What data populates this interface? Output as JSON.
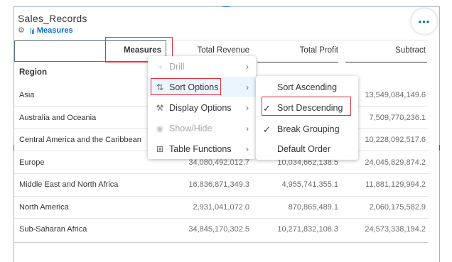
{
  "widget": {
    "title": "Sales_Records",
    "measure_link": "Measures",
    "more_label": "•••"
  },
  "table": {
    "header_dimension": "Measures",
    "columns": [
      "Total Revenue",
      "Total Profit",
      "Subtract"
    ],
    "row_header": "Region",
    "rows": [
      {
        "label": "Asia",
        "values": [
          "",
          "",
          "13,549,084,149.6"
        ]
      },
      {
        "label": "Australia and Oceania",
        "values": [
          "",
          "",
          "7,509,770,236.1"
        ]
      },
      {
        "label": "Central America and the Caribbean",
        "values": [
          "",
          "",
          "10,228,092,517.6"
        ]
      },
      {
        "label": "Europe",
        "values": [
          "34,080,492,012.7",
          "10,034,662,138.5",
          "24,045,829,874.2"
        ]
      },
      {
        "label": "Middle East and North Africa",
        "values": [
          "16,836,871,349.3",
          "4,955,741,355.1",
          "11,881,129,994.2"
        ]
      },
      {
        "label": "North America",
        "values": [
          "2,931,041,072.0",
          "870,865,489.1",
          "2,060,175,582.9"
        ]
      },
      {
        "label": "Sub-Saharan Africa",
        "values": [
          "34,845,170,302.5",
          "10,271,832,108.3",
          "24,573,338,194.2"
        ]
      }
    ]
  },
  "context_menu": {
    "items": [
      {
        "label": "Drill",
        "icon": "drill-icon",
        "disabled": true
      },
      {
        "label": "Sort Options",
        "icon": "sort-icon",
        "disabled": false,
        "selected": true
      },
      {
        "label": "Display Options",
        "icon": "wrench-icon",
        "disabled": false
      },
      {
        "label": "Show/Hide",
        "icon": "eye-icon",
        "disabled": true
      },
      {
        "label": "Table Functions",
        "icon": "table-icon",
        "disabled": false
      }
    ]
  },
  "sort_submenu": {
    "items": [
      {
        "label": "Sort Ascending",
        "checked": false
      },
      {
        "label": "Sort Descending",
        "checked": true
      },
      {
        "label": "Break Grouping",
        "checked": true
      },
      {
        "label": "Default Order",
        "checked": false
      }
    ]
  },
  "colors": {
    "accent": "#0a6ed1",
    "highlight_red": "#e0313a",
    "text": "#32363a",
    "muted": "#6a6d70"
  }
}
